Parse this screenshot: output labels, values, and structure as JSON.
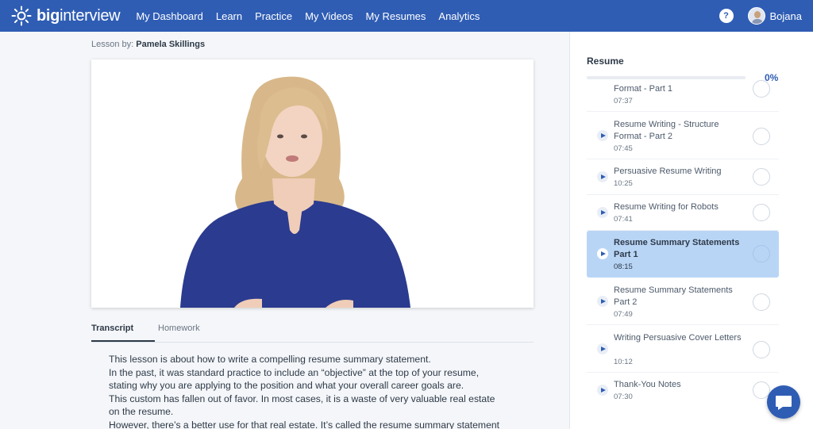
{
  "nav": {
    "logo_bold": "big",
    "logo_light": "interview",
    "links": [
      "My Dashboard",
      "Learn",
      "Practice",
      "My Videos",
      "My Resumes",
      "Analytics"
    ],
    "help_label": "?",
    "user_name": "Bojana"
  },
  "lesson": {
    "by_label": "Lesson by:",
    "instructor": "Pamela Skillings"
  },
  "tabs": {
    "transcript": "Transcript",
    "homework": "Homework",
    "active": "Transcript"
  },
  "transcript": [
    "This lesson is about how to write a compelling resume summary statement.",
    "In the past, it was standard practice to include an “objective” at the top of your resume,",
    "stating why you are applying to the position and what your overall career goals are.",
    "This custom has fallen out of favor. In most cases, it is a waste of very valuable real estate",
    "on the resume.",
    "However, there’s a better use for that real estate. It’s called the resume summary statement"
  ],
  "panel": {
    "title": "Resume",
    "progress_pct": "0%",
    "progress_value": 0,
    "items": [
      {
        "title": "Format - Part 1",
        "duration": "07:37",
        "active": false
      },
      {
        "title": "Resume Writing - Structure Format - Part 2",
        "duration": "07:45",
        "active": false
      },
      {
        "title": "Persuasive Resume Writing",
        "duration": "10:25",
        "active": false
      },
      {
        "title": "Resume Writing for Robots",
        "duration": "07:41",
        "active": false
      },
      {
        "title": "Resume Summary Statements Part 1",
        "duration": "08:15",
        "active": true
      },
      {
        "title": "Resume Summary Statements Part 2",
        "duration": "07:49",
        "active": false
      },
      {
        "title": "Writing Persuasive Cover Letters",
        "duration": "10:12",
        "active": false
      },
      {
        "title": "Thank-You Notes",
        "duration": "07:30",
        "active": false
      }
    ]
  },
  "colors": {
    "brand": "#2f5db4",
    "active_item": "#b9d5f6"
  },
  "icons": [
    "sun-logo-icon",
    "help-icon",
    "avatar",
    "play-icon",
    "check-circle-icon",
    "chat-icon"
  ]
}
